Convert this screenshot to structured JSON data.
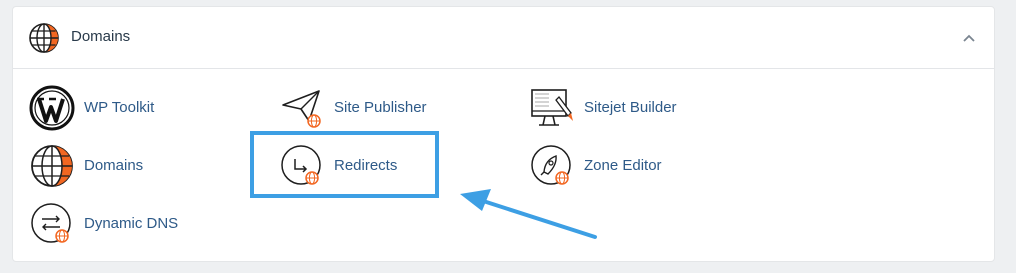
{
  "section": {
    "title": "Domains",
    "icon": "globe-icon",
    "collapse_icon": "chevron-up-icon"
  },
  "items": [
    {
      "label": "WP Toolkit",
      "icon": "wordpress-icon"
    },
    {
      "label": "Site Publisher",
      "icon": "paper-plane-icon"
    },
    {
      "label": "Sitejet Builder",
      "icon": "monitor-brush-icon"
    },
    {
      "label": "Domains",
      "icon": "globe-icon"
    },
    {
      "label": "Redirects",
      "icon": "redirect-arrow-icon"
    },
    {
      "label": "Zone Editor",
      "icon": "rocket-icon"
    },
    {
      "label": "Dynamic DNS",
      "icon": "swap-arrows-icon"
    }
  ],
  "colors": {
    "accent_orange": "#f26722",
    "link_blue": "#2e5a88",
    "highlight_blue": "#3d9fe4",
    "icon_dark": "#1e1e1e"
  }
}
